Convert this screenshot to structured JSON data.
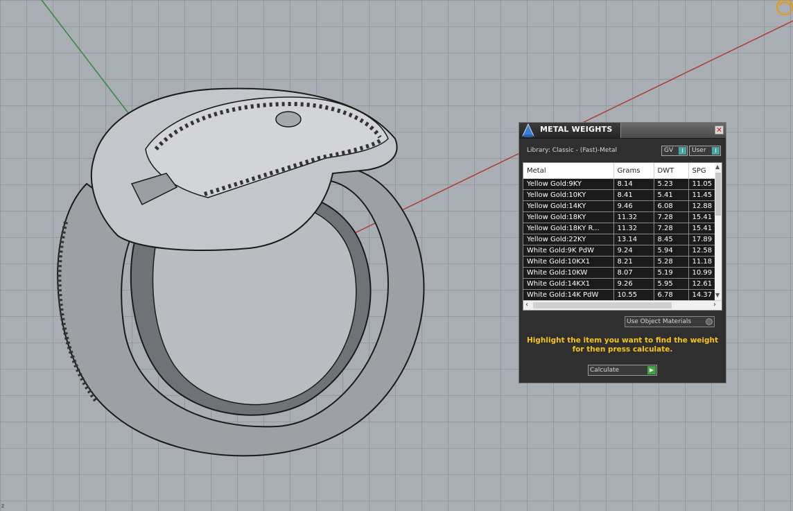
{
  "viewport": {
    "axis_label": "z",
    "cursor_icon": "gumball-widget-icon",
    "colors": {
      "background": "#a9adb4",
      "x_axis": "#b03a30",
      "y_axis": "#2e8b3e"
    }
  },
  "panel": {
    "title": "METAL WEIGHTS",
    "close_label": "✕",
    "library_label": "Library: Classic - (Fast)-Metal",
    "toggles": {
      "gv": "GV",
      "user": "User"
    },
    "table": {
      "columns": [
        "Metal",
        "Grams",
        "DWT",
        "SPG"
      ],
      "rows": [
        [
          "Yellow Gold:9KY",
          "8.14",
          "5.23",
          "11.05"
        ],
        [
          "Yellow Gold:10KY",
          "8.41",
          "5.41",
          "11.45"
        ],
        [
          "Yellow Gold:14KY",
          "9.46",
          "6.08",
          "12.88"
        ],
        [
          "Yellow Gold:18KY",
          "11.32",
          "7.28",
          "15.41"
        ],
        [
          "Yellow Gold:18KY R...",
          "11.32",
          "7.28",
          "15.41"
        ],
        [
          "Yellow Gold:22KY",
          "13.14",
          "8.45",
          "17.89"
        ],
        [
          "White Gold:9K PdW",
          "9.24",
          "5.94",
          "12.58"
        ],
        [
          "White Gold:10KX1",
          "8.21",
          "5.28",
          "11.18"
        ],
        [
          "White Gold:10KW",
          "8.07",
          "5.19",
          "10.99"
        ],
        [
          "White Gold:14KX1",
          "9.26",
          "5.95",
          "12.61"
        ],
        [
          "White Gold:14K PdW",
          "10.55",
          "6.78",
          "14.37"
        ]
      ]
    },
    "dropdown_label": "Use Object Materials",
    "instruction_line1": "Highlight the item you want to find the weight",
    "instruction_line2": "for then press calculate.",
    "calculate_label": "Calculate",
    "accent_color": "#f5c518"
  }
}
